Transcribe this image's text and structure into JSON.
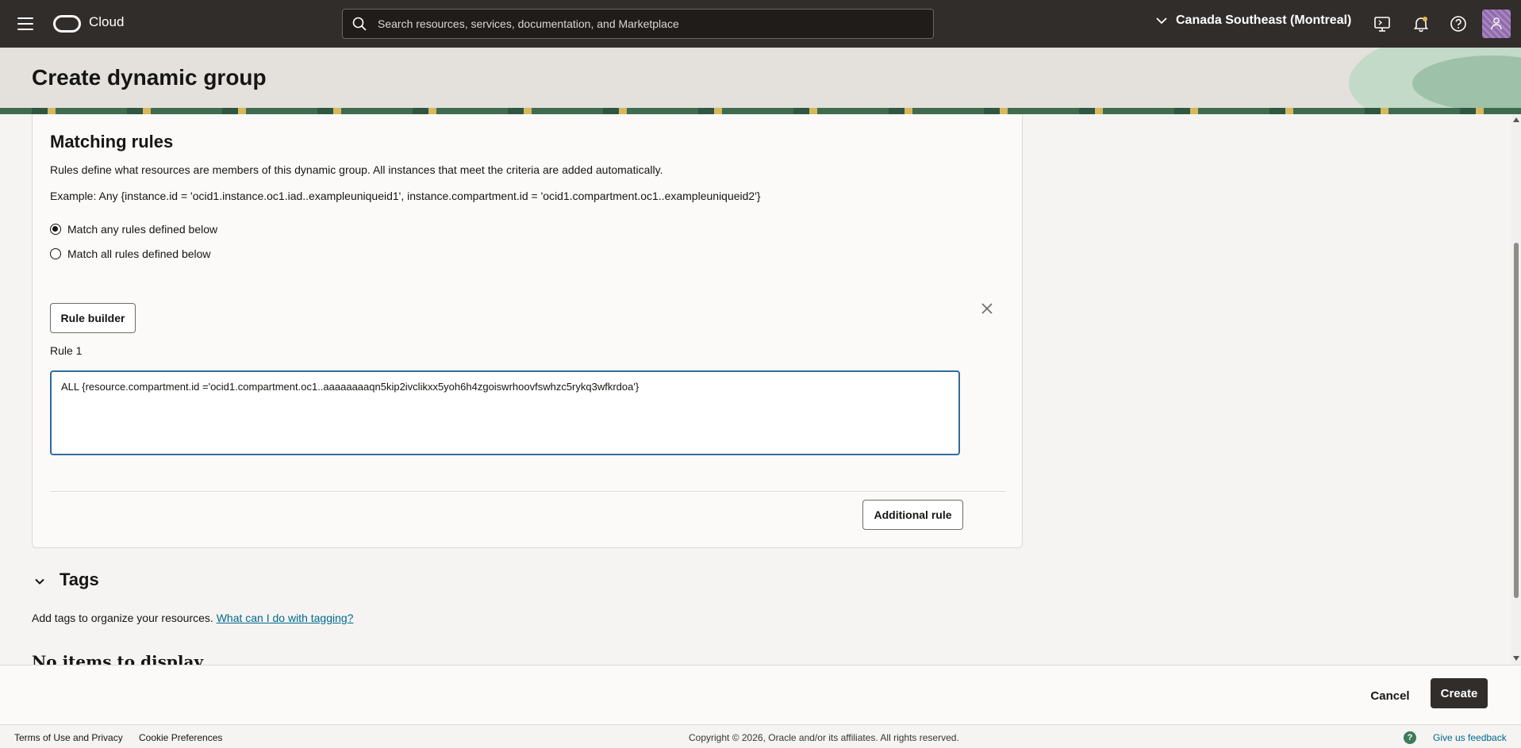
{
  "topbar": {
    "brand": "Cloud",
    "search_placeholder": "Search resources, services, documentation, and Marketplace",
    "region": "Canada Southeast (Montreal)"
  },
  "page": {
    "title": "Create dynamic group"
  },
  "matching_rules": {
    "title": "Matching rules",
    "description": "Rules define what resources are members of this dynamic group. All instances that meet the criteria are added automatically.",
    "example": "Example: Any {instance.id = 'ocid1.instance.oc1.iad..exampleuniqueid1', instance.compartment.id = 'ocid1.compartment.oc1..exampleuniqueid2'}",
    "options": [
      {
        "label": "Match any rules defined below",
        "checked": true
      },
      {
        "label": "Match all rules defined below",
        "checked": false
      }
    ],
    "rule_builder_label": "Rule builder",
    "rule_label": "Rule 1",
    "rule_value": "ALL {resource.compartment.id ='ocid1.compartment.oc1..aaaaaaaaqn5kip2ivclikxx5yoh6h4zgoiswrhoovfswhzc5rykq3wfkrdoa'}",
    "additional_rule_label": "Additional rule"
  },
  "tags": {
    "title": "Tags",
    "description": "Add tags to organize your resources.",
    "link": "What can I do with tagging?",
    "cut_heading": "No items to display"
  },
  "actions": {
    "cancel": "Cancel",
    "create": "Create"
  },
  "footer": {
    "terms": "Terms of Use and Privacy",
    "cookies": "Cookie Preferences",
    "copyright": "Copyright © 2026, Oracle and/or its affiliates. All rights reserved.",
    "feedback": "Give us feedback"
  }
}
